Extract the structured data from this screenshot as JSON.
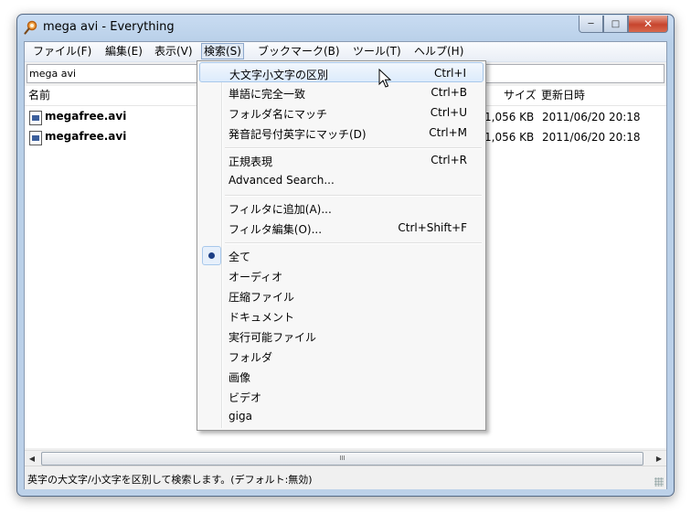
{
  "window": {
    "title": "mega avi - Everything",
    "controls": {
      "minimize": "─",
      "maximize": "□",
      "close": "✕"
    }
  },
  "menubar": {
    "items": [
      "ファイル(F)",
      "編集(E)",
      "表示(V)",
      "検索(S)",
      "ブックマーク(B)",
      "ツール(T)",
      "ヘルプ(H)"
    ],
    "active_index": 3
  },
  "search": {
    "value": "mega avi"
  },
  "list": {
    "columns": {
      "name": "名前",
      "size": "サイズ",
      "modified": "更新日時"
    },
    "rows": [
      {
        "name": "megafree.avi",
        "size": "1,056 KB",
        "modified": "2011/06/20 20:18"
      },
      {
        "name": "megafree.avi",
        "size": "1,056 KB",
        "modified": "2011/06/20 20:18"
      }
    ]
  },
  "dropdown": {
    "items": [
      {
        "label": "大文字小文字の区別",
        "shortcut": "Ctrl+I",
        "hovered": true
      },
      {
        "label": "単語に完全一致",
        "shortcut": "Ctrl+B"
      },
      {
        "label": "フォルダ名にマッチ",
        "shortcut": "Ctrl+U"
      },
      {
        "label": "発音記号付英字にマッチ(D)",
        "shortcut": "Ctrl+M"
      },
      {
        "label": "正規表現",
        "shortcut": "Ctrl+R"
      },
      {
        "label": "Advanced Search...",
        "shortcut": ""
      },
      {
        "label": "フィルタに追加(A)...",
        "shortcut": ""
      },
      {
        "label": "フィルタ編集(O)...",
        "shortcut": "Ctrl+Shift+F"
      },
      {
        "label": "全て",
        "shortcut": "",
        "selected": true
      },
      {
        "label": "オーディオ",
        "shortcut": ""
      },
      {
        "label": "圧縮ファイル",
        "shortcut": ""
      },
      {
        "label": "ドキュメント",
        "shortcut": ""
      },
      {
        "label": "実行可能ファイル",
        "shortcut": ""
      },
      {
        "label": "フォルダ",
        "shortcut": ""
      },
      {
        "label": "画像",
        "shortcut": ""
      },
      {
        "label": "ビデオ",
        "shortcut": ""
      },
      {
        "label": "giga",
        "shortcut": ""
      }
    ]
  },
  "scrollbar": {
    "left_arrow": "◀",
    "right_arrow": "▶",
    "thumb_grip": "III"
  },
  "status": {
    "text": "英字の大文字/小文字を区別して検索します。(デフォルト:無効)"
  },
  "colors": {
    "accent": "#dcebfc",
    "title_bar": "#bcd1e9",
    "close": "#c7442d"
  }
}
